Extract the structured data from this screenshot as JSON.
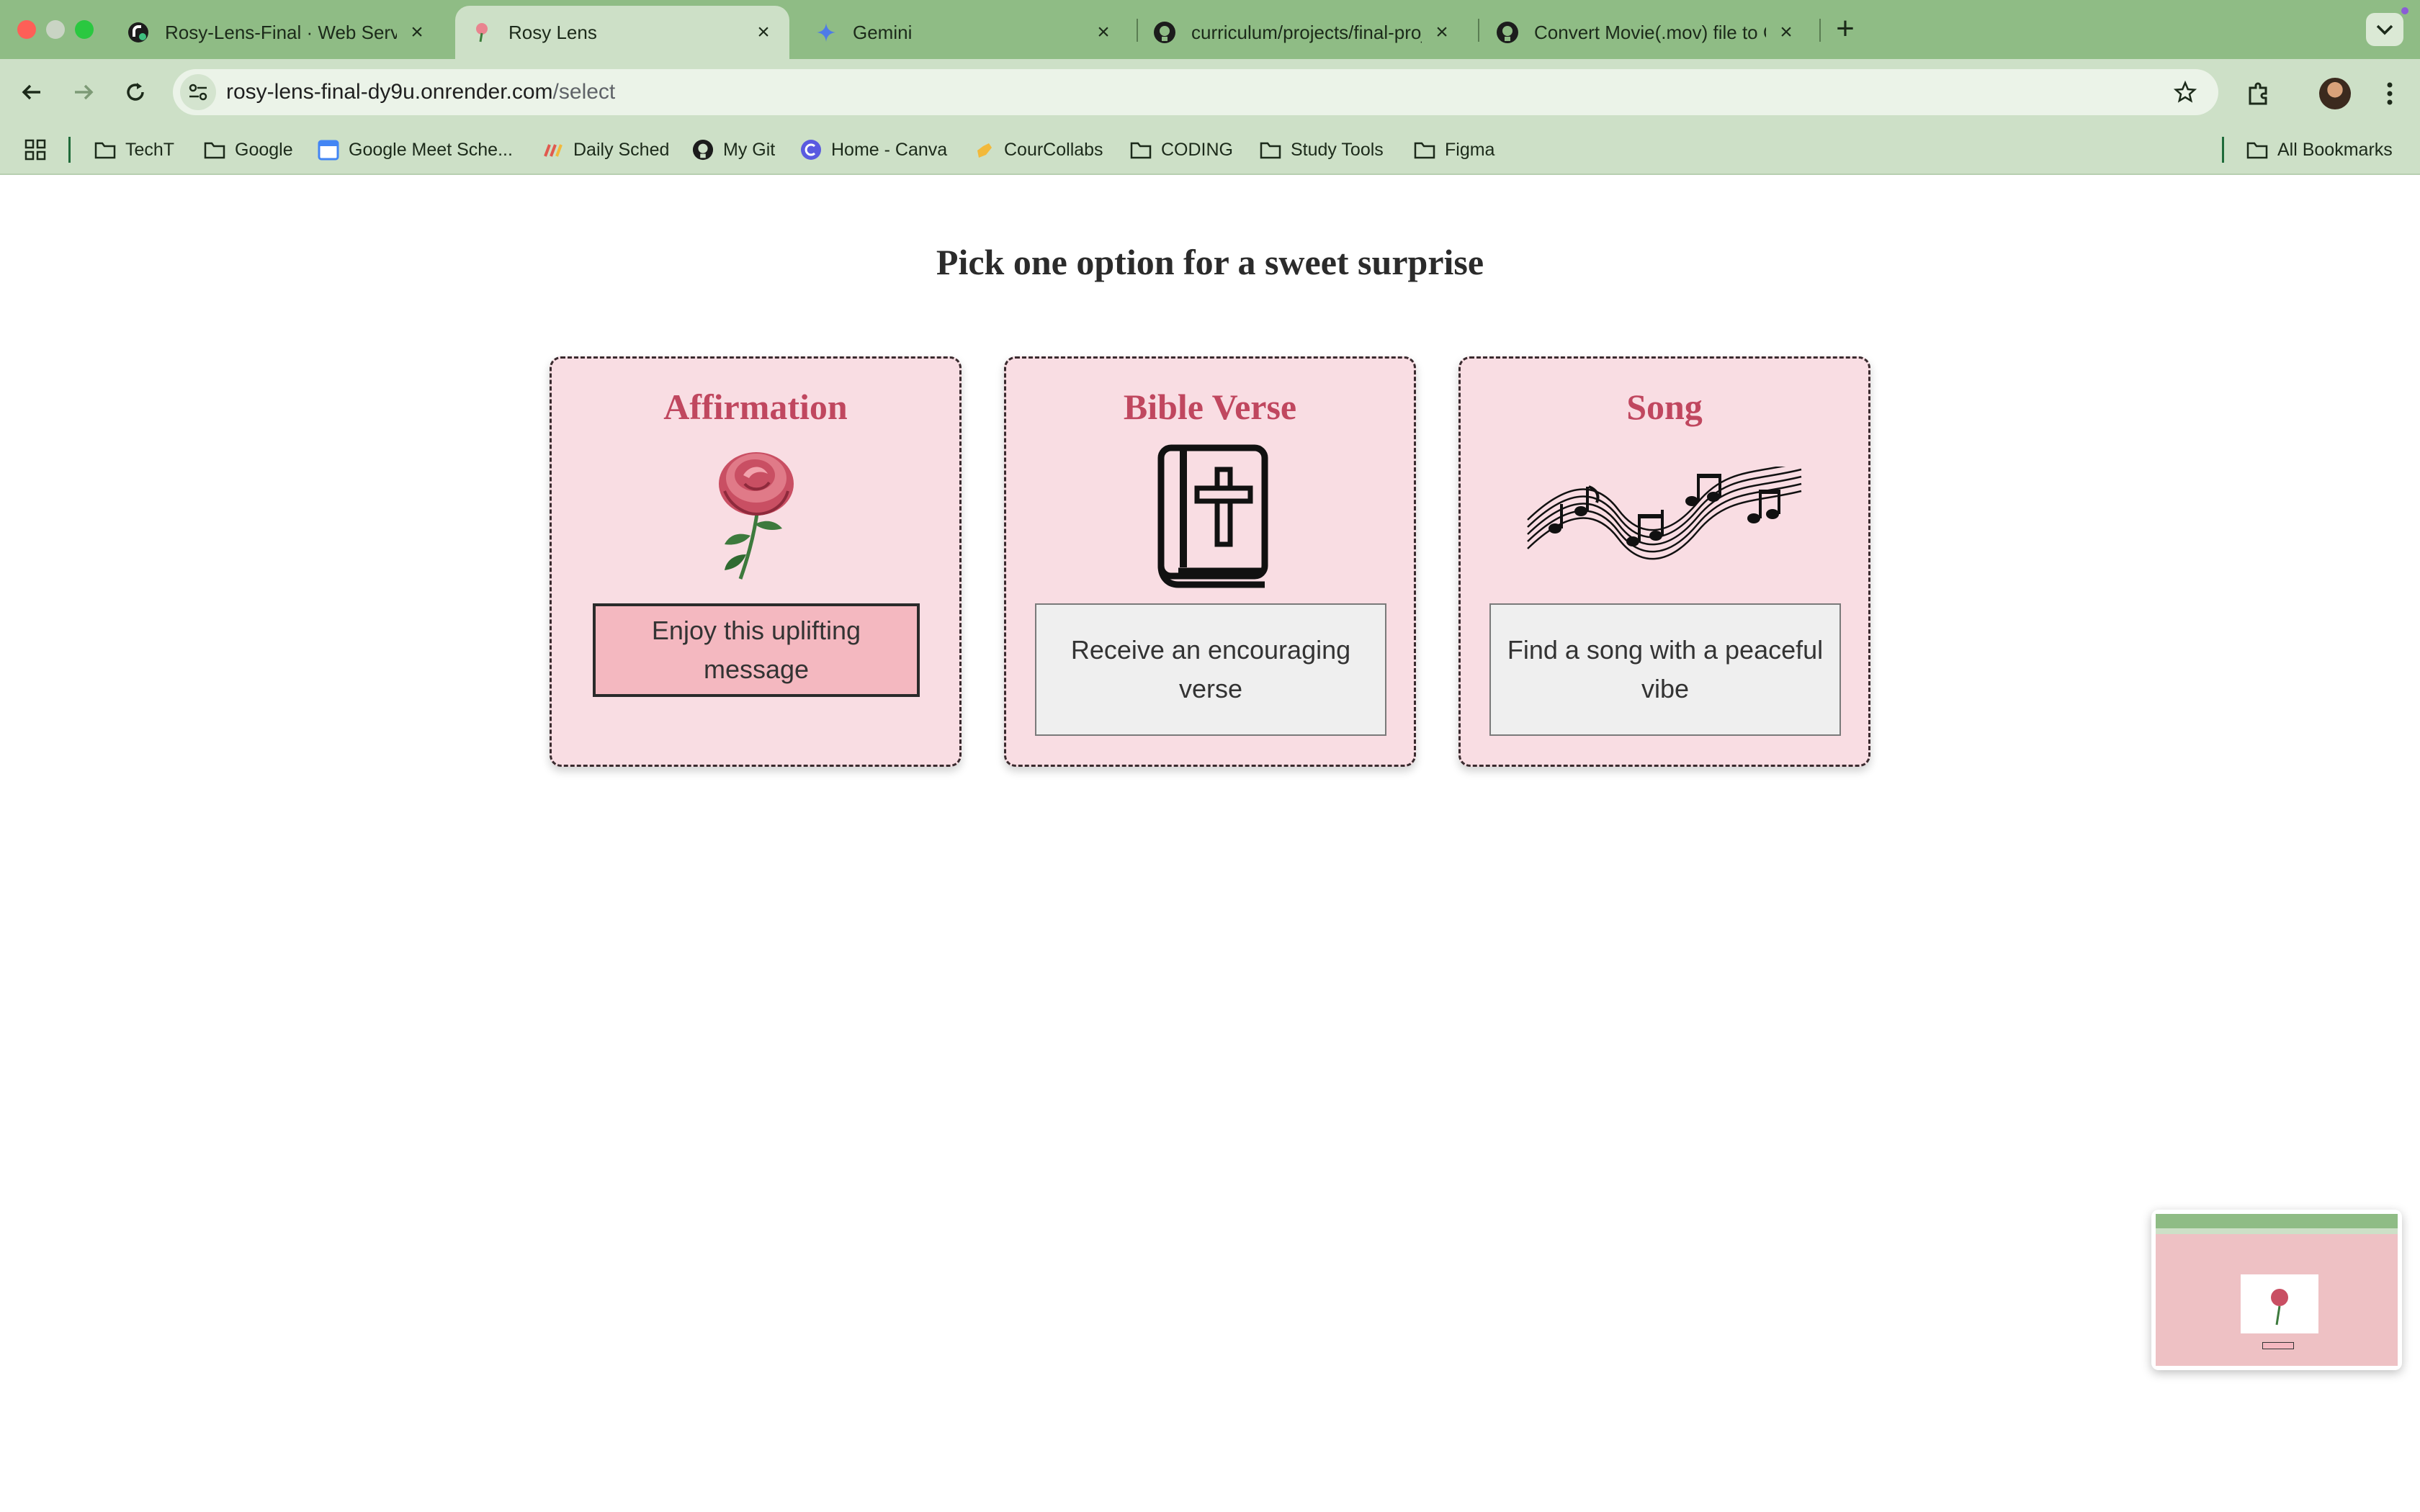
{
  "tabs": [
    {
      "title": "Rosy-Lens-Final · Web Serv",
      "icon": "render-logo-icon"
    },
    {
      "title": "Rosy Lens",
      "icon": "rose-favicon-icon",
      "active": true
    },
    {
      "title": "Gemini",
      "icon": "gemini-sparkle-icon"
    },
    {
      "title": "curriculum/projects/final-proj",
      "icon": "github-icon"
    },
    {
      "title": "Convert Movie(.mov) file to G",
      "icon": "github-icon"
    }
  ],
  "address_bar": {
    "host": "rosy-lens-final-dy9u.onrender.com",
    "path": "/select"
  },
  "bookmarks": [
    {
      "label": "TechT",
      "icon": "folder-icon"
    },
    {
      "label": "Google",
      "icon": "folder-icon"
    },
    {
      "label": "Google Meet Sche...",
      "icon": "calendar-icon"
    },
    {
      "label": "Daily Sched",
      "icon": "sched-icon"
    },
    {
      "label": "My Git",
      "icon": "github-icon"
    },
    {
      "label": "Home - Canva",
      "icon": "canva-icon"
    },
    {
      "label": "CourCollabs",
      "icon": "hand-icon"
    },
    {
      "label": "CODING",
      "icon": "folder-icon"
    },
    {
      "label": "Study Tools",
      "icon": "folder-icon"
    },
    {
      "label": "Figma",
      "icon": "folder-icon"
    }
  ],
  "all_bookmarks_label": "All Bookmarks",
  "page": {
    "heading": "Pick one option for a sweet surprise",
    "cards": [
      {
        "title": "Affirmation",
        "button": "Enjoy this uplifting message",
        "icon": "rose-icon",
        "selected": true
      },
      {
        "title": "Bible Verse",
        "button": "Receive an encouraging verse",
        "icon": "bible-icon"
      },
      {
        "title": "Song",
        "button": "Find a song with a peaceful vibe",
        "icon": "music-notes-icon"
      }
    ]
  },
  "colors": {
    "chrome_green": "#8fbc85",
    "toolbar_green": "#cde0c7",
    "card_bg": "#f9dde3",
    "title_pink": "#c0475f",
    "selected_button": "#f4b8c0"
  }
}
